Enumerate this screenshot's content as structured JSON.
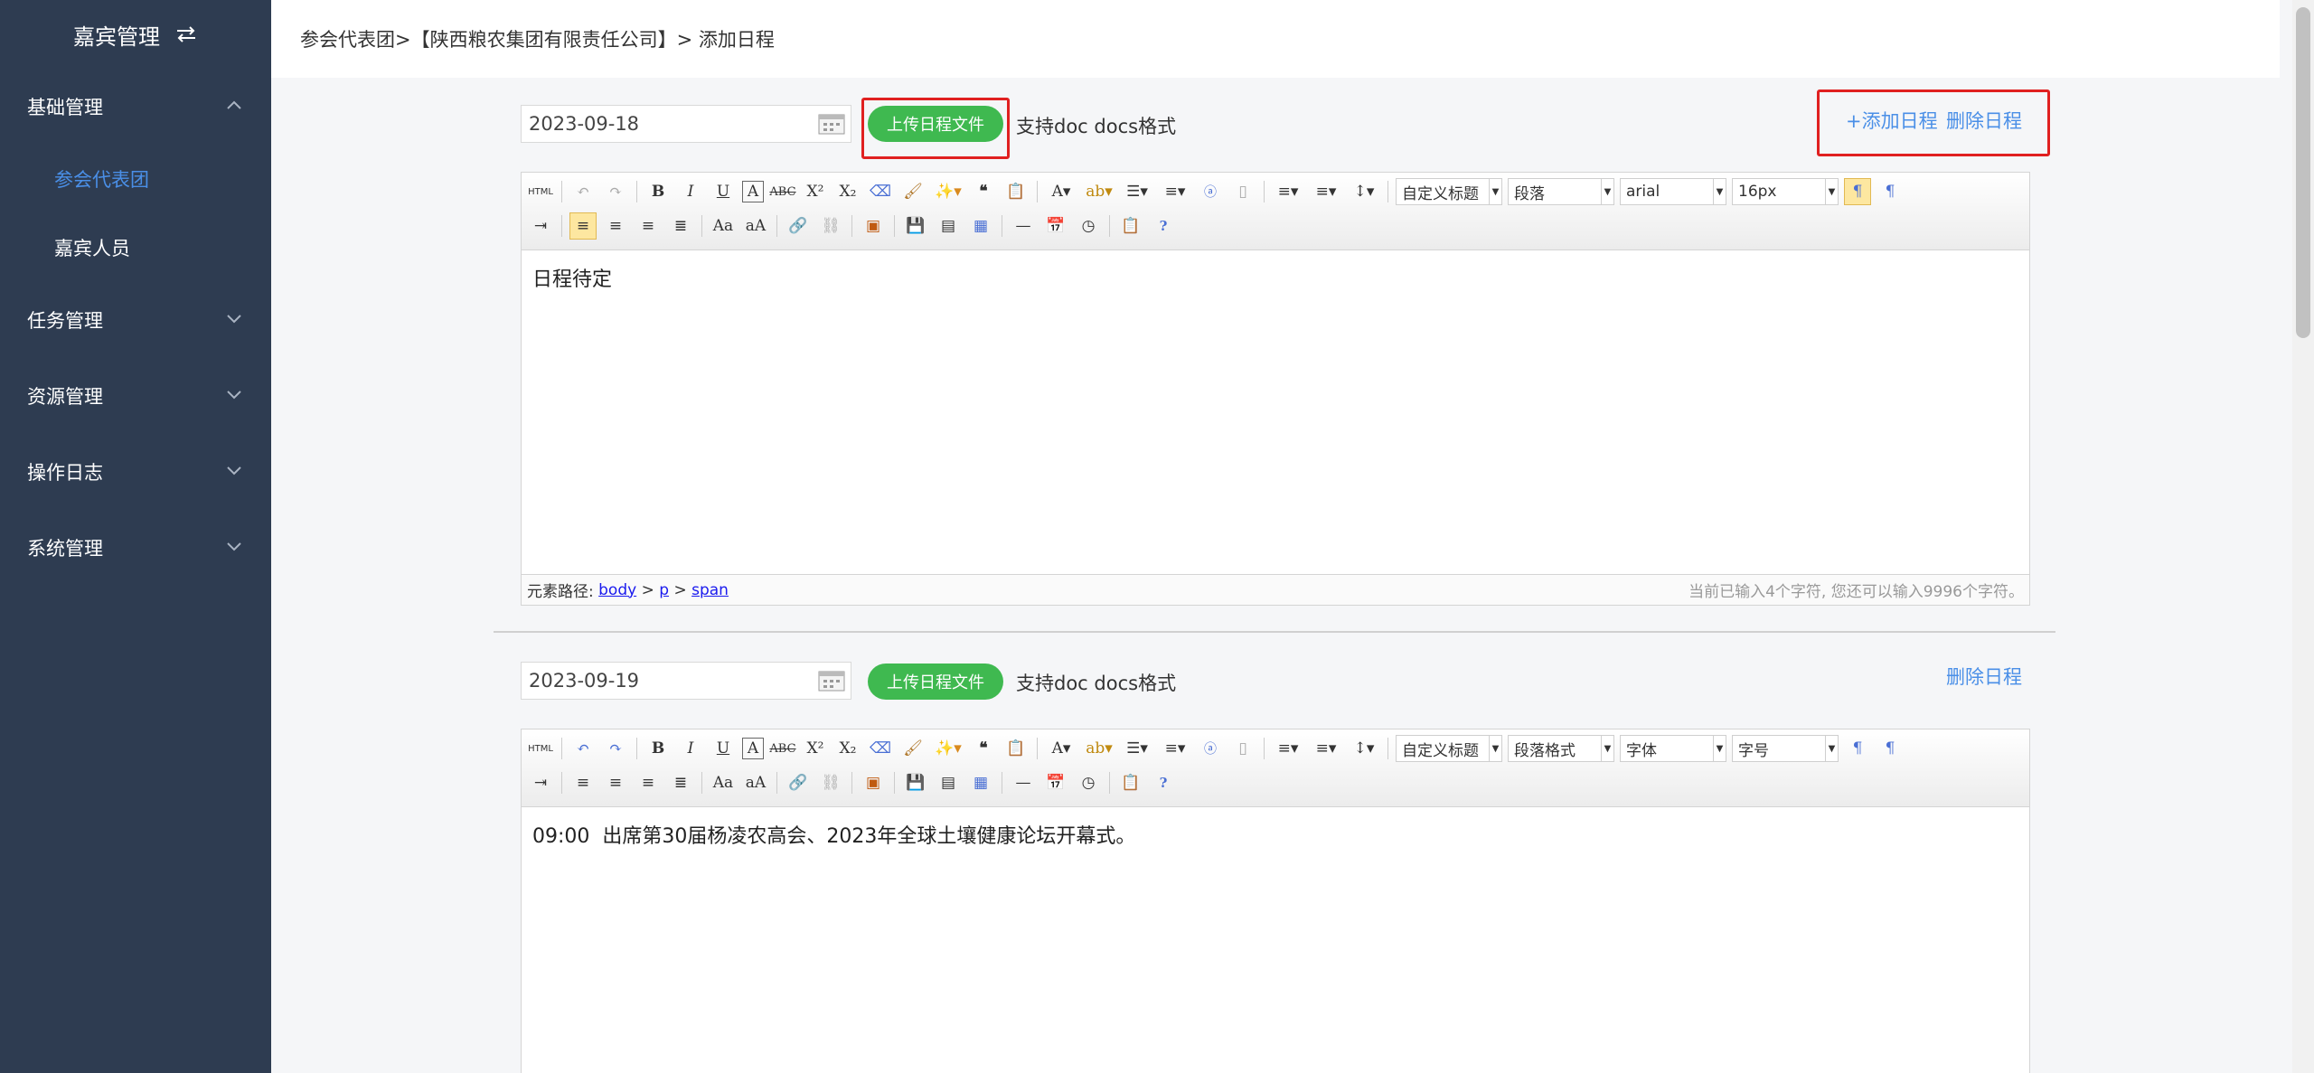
{
  "sidebar": {
    "title": "嘉宾管理",
    "menus": [
      {
        "label": "基础管理"
      },
      {
        "label": "任务管理"
      },
      {
        "label": "资源管理"
      },
      {
        "label": "操作日志"
      },
      {
        "label": "系统管理"
      }
    ],
    "sub_items": [
      {
        "label": "参会代表团",
        "active": true
      },
      {
        "label": "嘉宾人员",
        "active": false
      }
    ]
  },
  "breadcrumb": "参会代表团>【陕西粮农集团有限责任公司】> 添加日程",
  "schedules": [
    {
      "date": "2023-09-18",
      "upload_label": "上传日程文件",
      "hint": "支持doc docs格式",
      "add_link": "+添加日程",
      "delete_link": "删除日程",
      "toolbar": {
        "heading": "自定义标题",
        "paragraph": "段落",
        "font": "arial",
        "size": "16px"
      },
      "content": "日程待定",
      "status": {
        "path_label": "元素路径:",
        "path": [
          "body",
          "p",
          "span"
        ],
        "sep": ">",
        "count": "当前已输入4个字符, 您还可以输入9996个字符。"
      }
    },
    {
      "date": "2023-09-19",
      "upload_label": "上传日程文件",
      "hint": "支持doc docs格式",
      "delete_link": "删除日程",
      "toolbar": {
        "heading": "自定义标题",
        "paragraph": "段落格式",
        "font": "字体",
        "size": "字号"
      },
      "content": "09:00  出席第30届杨凌农高会、2023年全球土壤健康论坛开幕式。"
    }
  ],
  "colors": {
    "sidebar_bg": "#2e3c51",
    "accent": "#4a8fe7",
    "upload_btn": "#3fb950",
    "highlight": "#e02020"
  }
}
